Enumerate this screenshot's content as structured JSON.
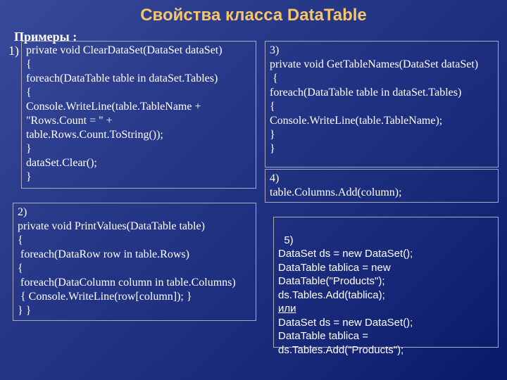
{
  "title": "Свойства класса DataTable",
  "examples_label": "Примеры :",
  "marker1": "1)",
  "box1": "private void ClearDataSet(DataSet dataSet)\n{\nforeach(DataTable table in dataSet.Tables)\n{\nConsole.WriteLine(table.TableName +\n\"Rows.Count = \" +\ntable.Rows.Count.ToString());\n}\ndataSet.Clear();\n}",
  "box2": "2)\nprivate void PrintValues(DataTable table)\n{\n foreach(DataRow row in table.Rows)\n{\n foreach(DataColumn column in table.Columns)\n { Console.WriteLine(row[column]); }\n} }",
  "box3": "3)\nprivate void GetTableNames(DataSet dataSet)\n {\nforeach(DataTable table in dataSet.Tables)\n{\nConsole.WriteLine(table.TableName);\n}\n}",
  "box4": "4)\ntable.Columns.Add(column);",
  "box5_pre": "5)\nDataSet ds = new DataSet();\nDataTable tablica = new DataTable(\"Products\");\nds.Tables.Add(tablica);",
  "box5_or": "или",
  "box5_post": "DataSet ds = new DataSet();\nDataTable tablica = ds.Tables.Add(\"Products\");"
}
